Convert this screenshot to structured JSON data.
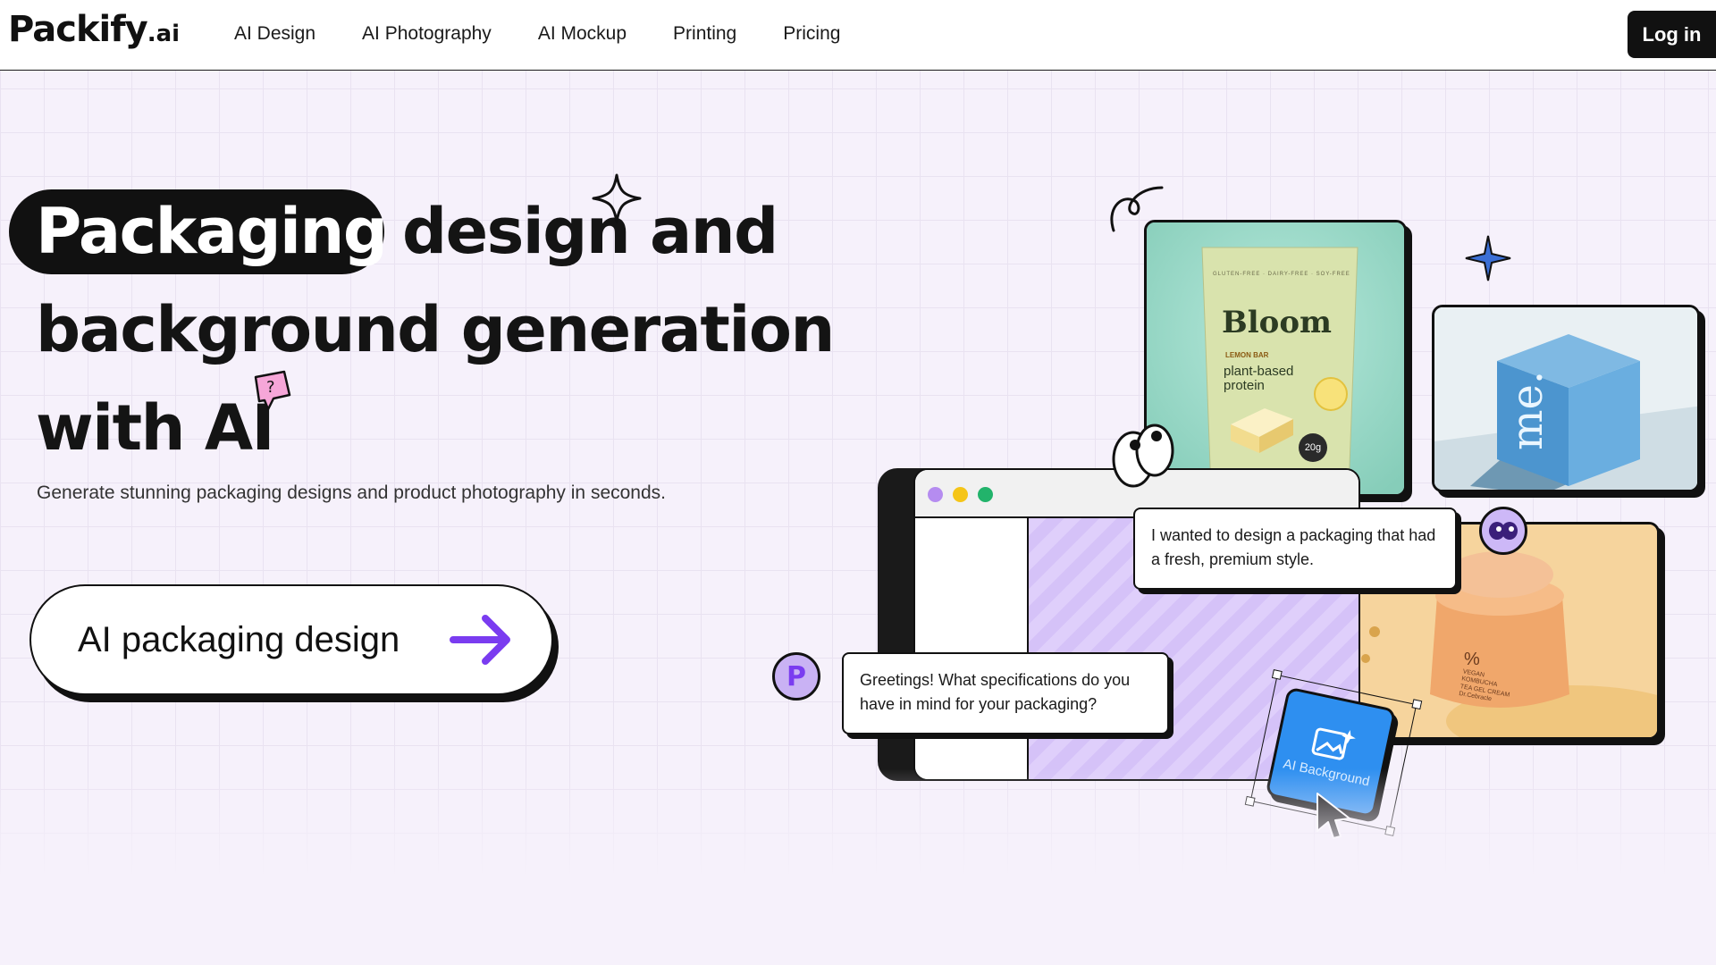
{
  "header": {
    "logo_main": "Packify",
    "logo_suffix": ".ai",
    "nav": [
      "AI Design",
      "AI Photography",
      "AI Mockup",
      "Printing",
      "Pricing"
    ],
    "login_label": "Log in"
  },
  "hero": {
    "headline_highlight": "Packaging",
    "headline_line1_rest": "design and",
    "headline_line2": "background generation",
    "headline_line3": "with AI",
    "subtitle": "Generate stunning packaging designs and product photography in seconds.",
    "cta_label": "AI packaging design"
  },
  "illustration": {
    "bloom_brand": "Bloom",
    "bloom_tagline": "LEMON BAR",
    "bloom_desc_1": "plant-based",
    "bloom_desc_2": "protein",
    "bloom_top_text": "GLUTEN-FREE · DAIRY-FREE · SOY-FREE",
    "bloom_badge": "20g",
    "me_brand": "me.",
    "jar_percent": "%",
    "jar_label_1": "VEGAN",
    "jar_label_2": "KOMBUCHA",
    "jar_label_3": "TEA GEL CREAM",
    "jar_label_4": "Dr.Cebracle",
    "bubble_user": "I wanted to design a packaging that had a fresh, premium style.",
    "bubble_bot": "Greetings! What specifications do you have in mind for your packaging?",
    "avatar_letter": "P",
    "ai_background_label": "AI Background"
  },
  "colors": {
    "accent_purple": "#7a3cf0",
    "ai_blue": "#2e8ff0",
    "dot_purple": "#b58cf0",
    "dot_yellow": "#f5c518",
    "dot_green": "#22b36b"
  }
}
